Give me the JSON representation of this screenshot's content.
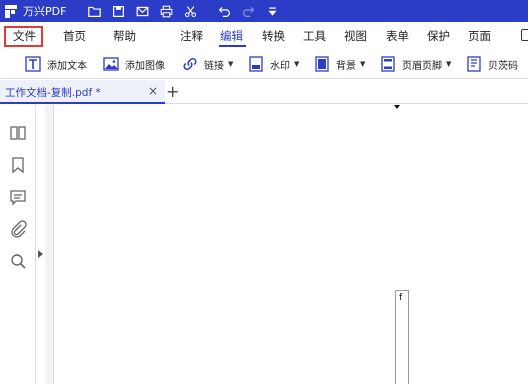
{
  "app": {
    "name": "万兴PDF"
  },
  "menu": {
    "file": "文件",
    "home": "首页",
    "help": "帮助",
    "comment": "注释",
    "edit": "编辑",
    "convert": "转换",
    "tools": "工具",
    "view": "视图",
    "form": "表单",
    "protect": "保护",
    "page": "页面"
  },
  "toolbar": {
    "add_text": "添加文本",
    "add_image": "添加图像",
    "link": "链接",
    "watermark": "水印",
    "background": "背景",
    "header_footer": "页眉页脚",
    "bates": "贝茨码"
  },
  "tab": {
    "title": "工作文档-复制.pdf *",
    "close": "×",
    "add": "+"
  },
  "document": {
    "text_fragment": "f"
  },
  "colors": {
    "brand": "#2b3cc6",
    "highlight": "#e53935"
  }
}
